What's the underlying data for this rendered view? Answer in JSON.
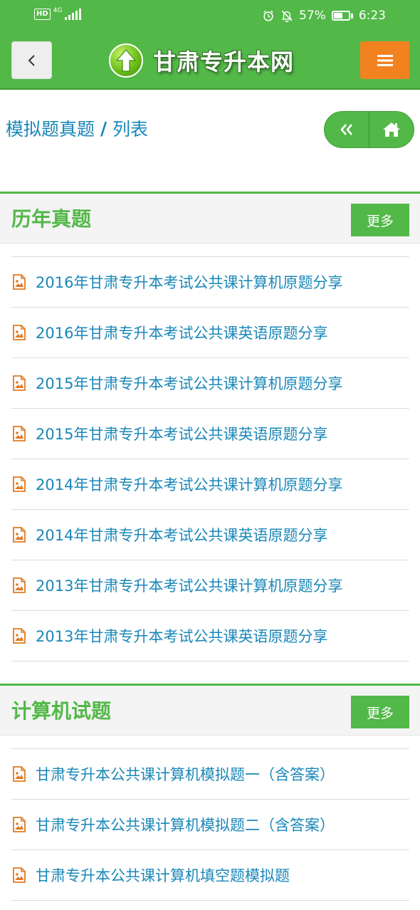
{
  "status_bar": {
    "hd": "HD",
    "network": "4G",
    "battery": "57%",
    "time": "6:23",
    "icons": [
      "alarm-icon",
      "bell-off-icon",
      "battery-icon",
      "signal-icon"
    ]
  },
  "header": {
    "logo_text": "甘肃专升本网",
    "back_icon": "chevron-left-icon",
    "menu_icon": "hamburger-icon",
    "colors": {
      "primary": "#52b848",
      "menu": "#f28120",
      "link": "#1a87b8"
    }
  },
  "breadcrumb": {
    "parent": "模拟题真题",
    "separator": "/",
    "current": "列表"
  },
  "nav_pill": {
    "left_icon": "double-chevron-left-icon",
    "right_icon": "home-icon"
  },
  "sections": [
    {
      "title": "历年真题",
      "more_label": "更多",
      "items": [
        "2016年甘肃专升本考试公共课计算机原题分享",
        "2016年甘肃专升本考试公共课英语原题分享",
        "2015年甘肃专升本考试公共课计算机原题分享",
        "2015年甘肃专升本考试公共课英语原题分享",
        "2014年甘肃专升本考试公共课计算机原题分享",
        "2014年甘肃专升本考试公共课英语原题分享",
        "2013年甘肃专升本考试公共课计算机原题分享",
        "2013年甘肃专升本考试公共课英语原题分享"
      ]
    },
    {
      "title": "计算机试题",
      "more_label": "更多",
      "items": [
        "甘肃专升本公共课计算机模拟题一（含答案）",
        "甘肃专升本公共课计算机模拟题二（含答案）",
        "甘肃专升本公共课计算机填空题模拟题"
      ]
    }
  ]
}
